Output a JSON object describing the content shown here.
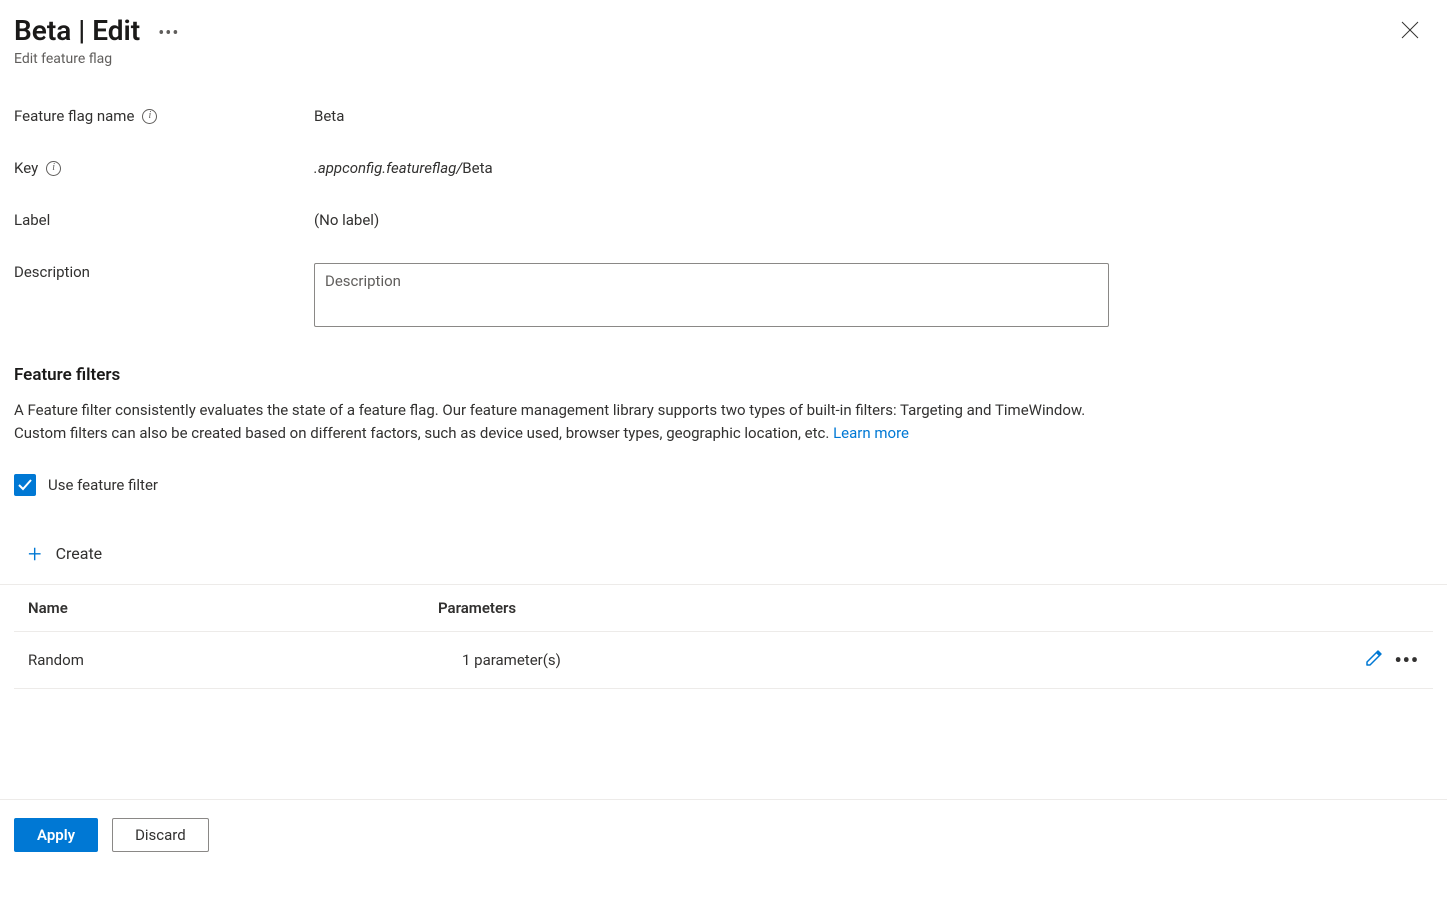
{
  "header": {
    "title": "Beta | Edit",
    "subtitle": "Edit feature flag"
  },
  "form": {
    "name_label": "Feature flag name",
    "name_value": "Beta",
    "key_label": "Key",
    "key_prefix": ".appconfig.featureflag/",
    "key_suffix": "Beta",
    "label_label": "Label",
    "label_value": "(No label)",
    "description_label": "Description",
    "description_placeholder": "Description"
  },
  "filters": {
    "heading": "Feature filters",
    "description": "A Feature filter consistently evaluates the state of a feature flag. Our feature management library supports two types of built-in filters: Targeting and TimeWindow. Custom filters can also be created based on different factors, such as device used, browser types, geographic location, etc. ",
    "learn_more": "Learn more",
    "use_filter_label": "Use feature filter",
    "create_label": "Create",
    "table": {
      "col_name": "Name",
      "col_params": "Parameters",
      "rows": [
        {
          "name": "Random",
          "params": "1 parameter(s)"
        }
      ]
    }
  },
  "footer": {
    "apply": "Apply",
    "discard": "Discard"
  }
}
